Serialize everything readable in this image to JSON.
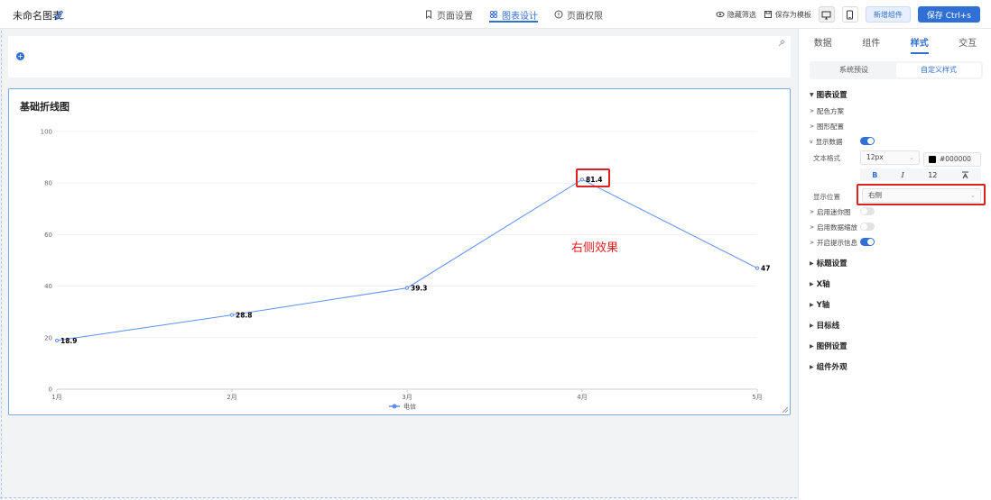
{
  "header": {
    "title": "未命名图表",
    "tabs": [
      {
        "label": "页面设置",
        "icon": "bookmark-icon"
      },
      {
        "label": "图表设计",
        "icon": "chart-design-icon"
      },
      {
        "label": "页面权限",
        "icon": "permission-icon"
      }
    ],
    "active_tab": 1,
    "hide_filter_label": "隐藏筛选",
    "save_template_label": "保存为模板",
    "add_component_label": "新增组件",
    "save_label": "保存 Ctrl+s"
  },
  "chart_card": {
    "title": "基础折线图"
  },
  "chart_data": {
    "type": "line",
    "categories": [
      "1月",
      "2月",
      "3月",
      "4月",
      "5月"
    ],
    "series": [
      {
        "name": "电信",
        "values": [
          18.9,
          28.8,
          39.3,
          81.4,
          47
        ],
        "color": "#5b8ff9"
      }
    ],
    "ylim": [
      0,
      100
    ],
    "yticks": [
      0,
      20,
      40,
      60,
      80,
      100
    ],
    "grid": true,
    "legend": "bottom-center",
    "data_labels": "right",
    "title": "基础折线图"
  },
  "annotation": {
    "text": "右侧效果",
    "color": "#e02020"
  },
  "panel": {
    "tabs": [
      "数据",
      "组件",
      "样式",
      "交互"
    ],
    "active_tab": 2,
    "segments": [
      "系统预设",
      "自定义样式"
    ],
    "active_segment": 1,
    "chart_settings_label": "图表设置",
    "color_scheme_label": "配色方案",
    "shape_config_label": "图形配置",
    "show_data_label": "显示数据",
    "show_data_on": true,
    "text_format_label": "文本格式",
    "font_size_value": "12px",
    "font_color_value": "#000000",
    "format_bold": "B",
    "format_italic": "I",
    "format_size": "12",
    "position_label": "显示位置",
    "position_value": "右侧",
    "mini_chart_label": "启用迷你图",
    "mini_chart_on": false,
    "data_zoom_label": "启用数据缩放",
    "data_zoom_on": false,
    "tooltip_label": "开启提示信息",
    "tooltip_on": true,
    "sections": [
      "标题设置",
      "X轴",
      "Y轴",
      "目标线",
      "图例设置",
      "组件外观"
    ]
  },
  "colors": {
    "accent": "#2f6fd6",
    "highlight": "#e02020"
  }
}
